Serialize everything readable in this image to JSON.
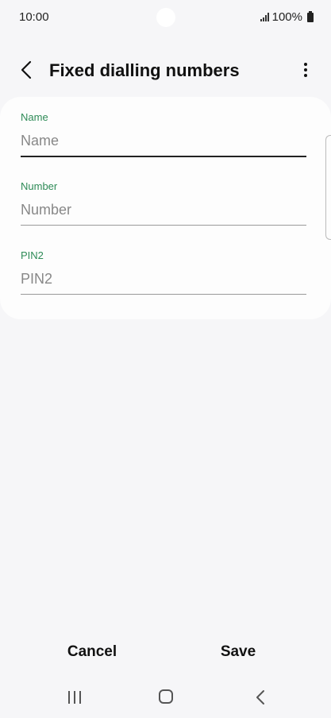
{
  "status_bar": {
    "time": "10:00",
    "battery": "100%"
  },
  "header": {
    "title": "Fixed dialling numbers",
    "icons": [
      "back-arrow-icon",
      "more-options-icon"
    ]
  },
  "form": {
    "fields": [
      {
        "label": "Name",
        "placeholder": "Name",
        "value": ""
      },
      {
        "label": "Number",
        "placeholder": "Number",
        "value": ""
      },
      {
        "label": "PIN2",
        "placeholder": "PIN2",
        "value": ""
      }
    ],
    "accent_color": "#2e8b57"
  },
  "actions": {
    "cancel_label": "Cancel",
    "save_label": "Save"
  },
  "nav_bar": {
    "icons": [
      "recents-icon",
      "home-icon",
      "back-icon"
    ]
  }
}
